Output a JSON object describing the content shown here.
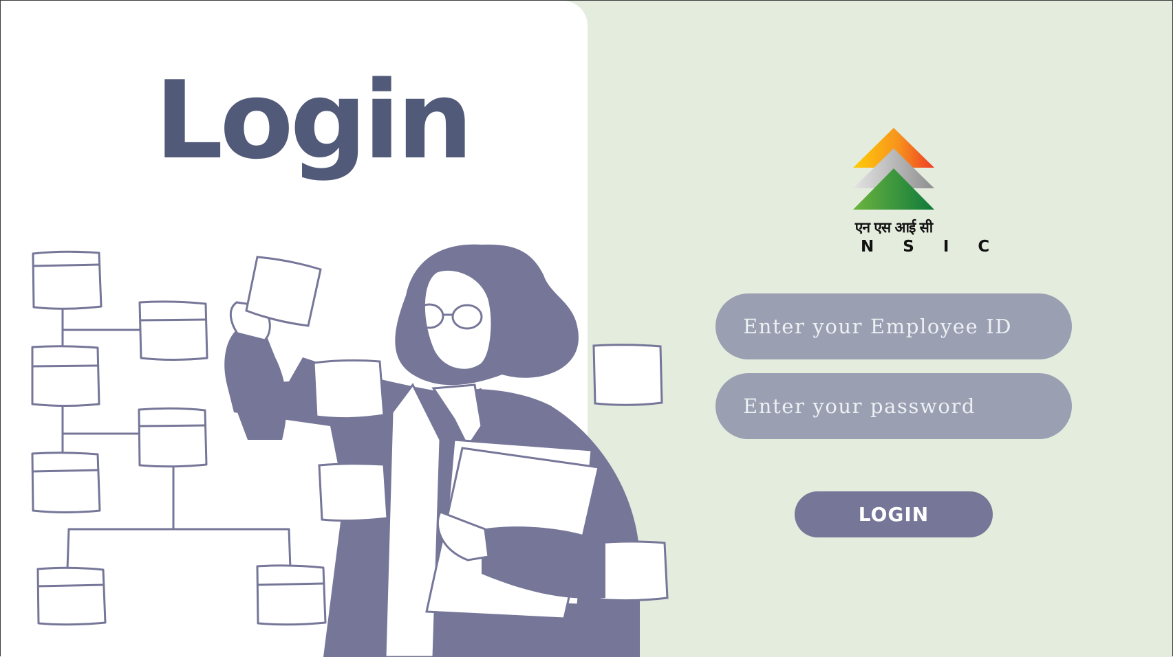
{
  "page": {
    "title": "Login"
  },
  "brand": {
    "hindi_name": "एन एस आई सी",
    "name": "N S I C",
    "logo_icon": "nsic-tricolor-chevron-logo",
    "colors": {
      "saffron": "#f7941d",
      "grey": "#9a9a9a",
      "green": "#1b8f3a"
    }
  },
  "form": {
    "employee_id": {
      "placeholder": "Enter your Employee ID",
      "value": ""
    },
    "password": {
      "placeholder": "Enter your password",
      "value": ""
    },
    "submit_label": "LOGIN"
  },
  "colors": {
    "left_background": "#ffffff",
    "right_background": "#e4ecdd",
    "accent": "#757698",
    "title": "#525a79",
    "field": "#9a9fb2"
  },
  "illustration": "woman-with-flowchart-illustration"
}
